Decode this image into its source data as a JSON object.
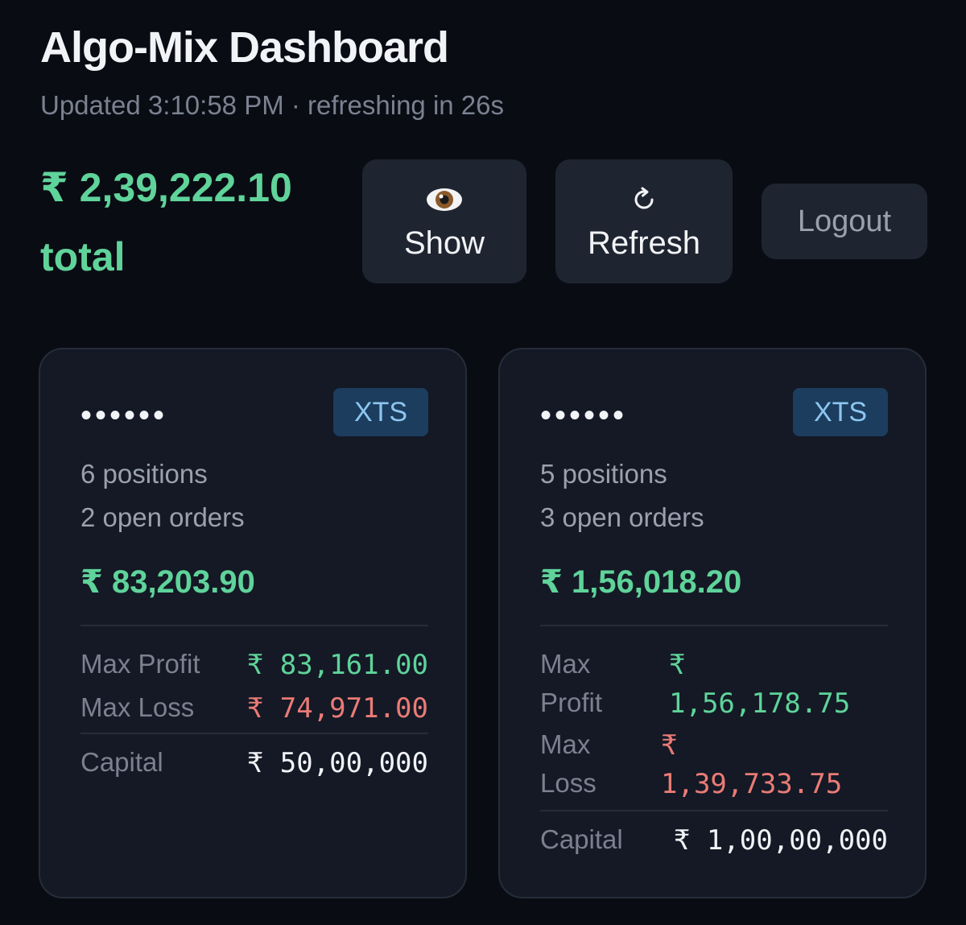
{
  "header": {
    "title": "Algo-Mix Dashboard",
    "subtitle": "Updated 3:10:58 PM · refreshing in 26s"
  },
  "summary": {
    "total_amount": "₹ 2,39,222.10",
    "total_label": "total"
  },
  "toolbar": {
    "show_icon": "eye-icon",
    "show_label": "Show",
    "refresh_icon": "refresh-icon",
    "refresh_label": "Refresh",
    "logout_label": "Logout"
  },
  "accounts": [
    {
      "name": "••••••",
      "broker": "XTS",
      "positions": "6 positions",
      "open_orders": "2 open orders",
      "pnl": "₹ 83,203.90",
      "max_profit_label": "Max Profit",
      "max_profit_value": "₹ 83,161.00",
      "max_loss_label": "Max Loss",
      "max_loss_value": "₹ 74,971.00",
      "capital_label": "Capital",
      "capital_value": "₹ 50,00,000"
    },
    {
      "name": "••••••",
      "broker": "XTS",
      "positions": "5 positions",
      "open_orders": "3 open orders",
      "pnl": "₹ 1,56,018.20",
      "max_profit_label_1": "Max",
      "max_profit_label_2": "Profit",
      "max_profit_currency": "₹",
      "max_profit_value": "1,56,178.75",
      "max_loss_label_1": "Max",
      "max_loss_label_2": "Loss",
      "max_loss_currency": "₹",
      "max_loss_value": "1,39,733.75",
      "capital_label": "Capital",
      "capital_value": "₹ 1,00,00,000"
    }
  ],
  "colors": {
    "background": "#0a0c14",
    "card": "#141925",
    "positive": "#5fd39a",
    "negative": "#ea7b76",
    "badge": "#1c3d5e"
  }
}
